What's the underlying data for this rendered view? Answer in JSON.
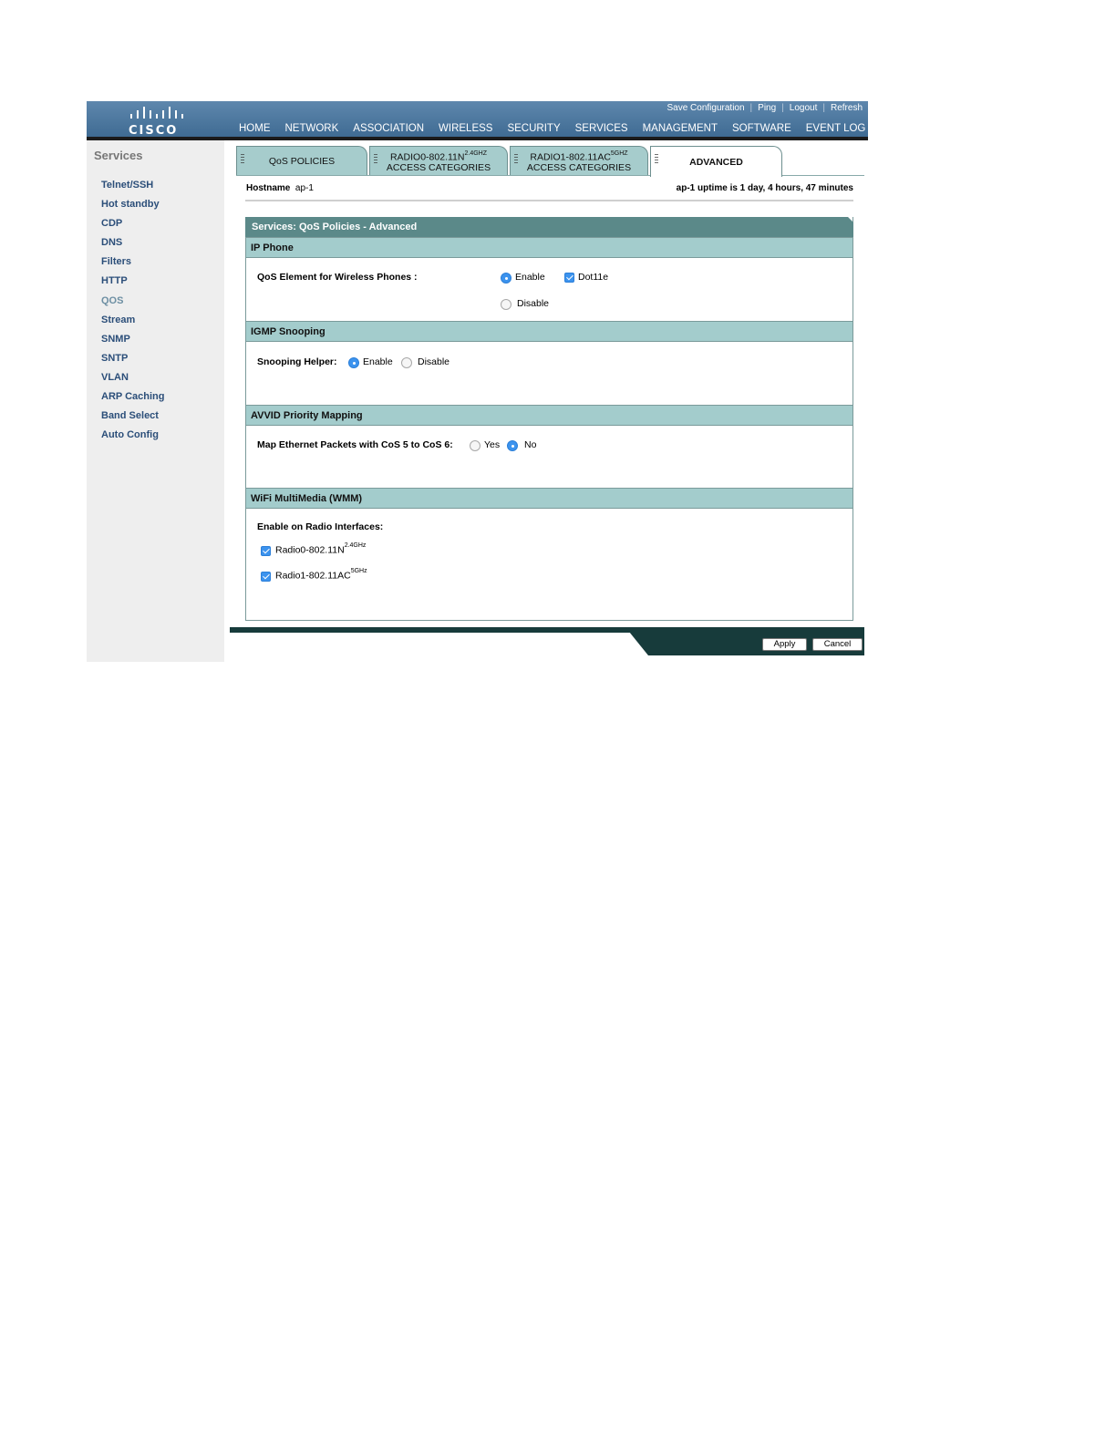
{
  "header": {
    "logo_text": "CISCO",
    "util_links": [
      "Save Configuration",
      "Ping",
      "Logout",
      "Refresh"
    ],
    "nav": [
      "HOME",
      "NETWORK",
      "ASSOCIATION",
      "WIRELESS",
      "SECURITY",
      "SERVICES",
      "MANAGEMENT",
      "SOFTWARE",
      "EVENT LOG"
    ],
    "active_nav": "SERVICES"
  },
  "sidebar": {
    "title": "Services",
    "items": [
      "Telnet/SSH",
      "Hot standby",
      "CDP",
      "DNS",
      "Filters",
      "HTTP",
      "QOS",
      "Stream",
      "SNMP",
      "SNTP",
      "VLAN",
      "ARP Caching",
      "Band Select",
      "Auto Config"
    ],
    "current": "QOS"
  },
  "tabs": [
    {
      "label": "QoS POLICIES"
    },
    {
      "line1": "RADIO0-802.11N",
      "sup": "2.4GHZ",
      "line2": "ACCESS CATEGORIES"
    },
    {
      "line1": "RADIO1-802.11AC",
      "sup": "5GHZ",
      "line2": "ACCESS CATEGORIES"
    },
    {
      "label": "ADVANCED",
      "active": true
    }
  ],
  "info": {
    "host_label": "Hostname",
    "host_value": "ap-1",
    "uptime": "ap-1 uptime is 1 day, 4 hours, 47 minutes"
  },
  "panel": {
    "title": "Services: QoS Policies - Advanced",
    "ip_phone": {
      "heading": "IP Phone",
      "label": "QoS Element for Wireless Phones :",
      "enable": "Enable",
      "disable": "Disable",
      "dot11e": "Dot11e",
      "selected": "Enable",
      "dot11e_checked": true
    },
    "igmp": {
      "heading": "IGMP Snooping",
      "label": "Snooping Helper:",
      "enable": "Enable",
      "disable": "Disable",
      "selected": "Enable"
    },
    "avvid": {
      "heading": "AVVID Priority Mapping",
      "label": "Map Ethernet Packets with CoS 5 to CoS 6:",
      "yes": "Yes",
      "no": "No",
      "selected": "No"
    },
    "wmm": {
      "heading": "WiFi MultiMedia (WMM)",
      "label": "Enable on Radio Interfaces:",
      "radio0": "Radio0-802.11N",
      "radio0_sup": "2.4GHz",
      "radio1": "Radio1-802.11AC",
      "radio1_sup": "5GHz",
      "radio0_checked": true,
      "radio1_checked": true
    }
  },
  "buttons": {
    "apply": "Apply",
    "cancel": "Cancel"
  },
  "colors": {
    "header_blue": "#4a779f",
    "active_nav_underline": "#e8a02a",
    "section_teal": "#a3cccc",
    "panel_title_teal": "#5b8989",
    "footer_dark": "#173b3b",
    "link_blue": "#2b4e79"
  }
}
